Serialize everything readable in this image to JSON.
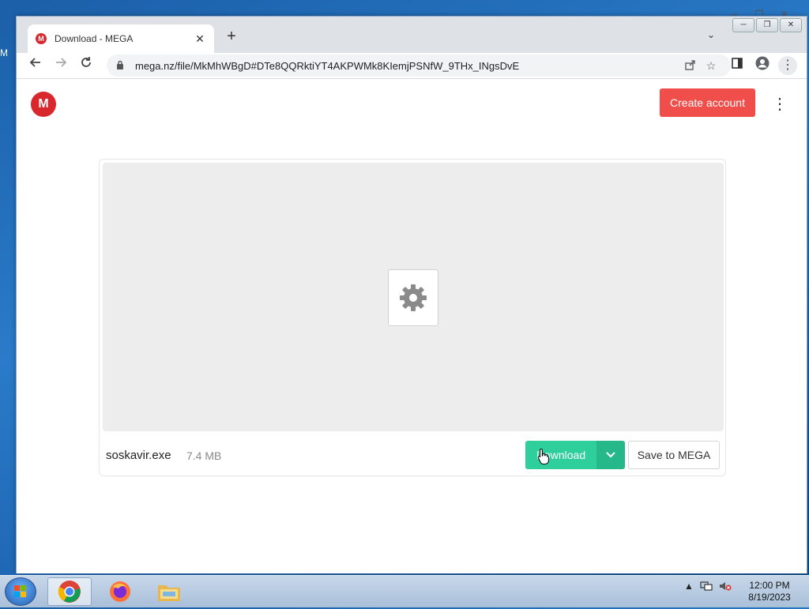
{
  "desktop": {
    "edge_label": "M"
  },
  "browser": {
    "tab": {
      "title": "Download - MEGA",
      "favicon": "M",
      "close": "✕"
    },
    "new_tab": "+",
    "tab_dropdown": "⌄",
    "window_controls": [
      "─",
      "❐",
      "✕"
    ],
    "url": "mega.nz/file/MkMhWBgD#DTe8QQRktiYT4AKPWMk8KIemjPSNfW_9THx_INgsDvE"
  },
  "page": {
    "logo": "M",
    "create_account": "Create account",
    "menu": "⋮",
    "file": {
      "name": "soskavir.exe",
      "size": "7.4 MB",
      "icon": "gear-icon"
    },
    "download_label": "Download",
    "save_to_mega_label": "Save to MEGA"
  },
  "taskbar": {
    "time": "12:00 PM",
    "date": "8/19/2023"
  },
  "colors": {
    "mega_red": "#d9272e",
    "create_account_bg": "#f04e4a",
    "download_green": "#2fcf9b",
    "download_dropdown_green": "#26b888"
  }
}
